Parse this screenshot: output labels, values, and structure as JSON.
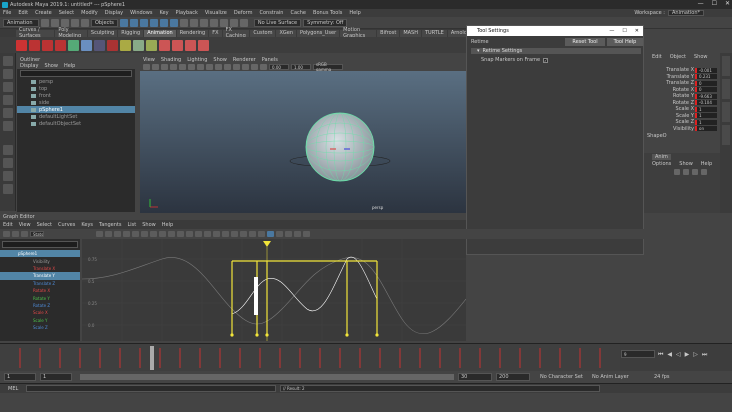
{
  "window": {
    "title": "Autodesk Maya 2019.1: untitled* --- pSphere1",
    "workspace": "Workspace :",
    "workspace_value": "Animation*"
  },
  "menubar": [
    "File",
    "Edit",
    "Create",
    "Select",
    "Modify",
    "Display",
    "Windows",
    "Key",
    "Playback",
    "Visualize",
    "Deform",
    "Constrain",
    "Cache",
    "Bonus Tools",
    "Help"
  ],
  "toolbar": {
    "menu_set": "Animation",
    "objects_label": "Objects",
    "live_surface": "No Live Surface",
    "symmetry": "Symmetry: Off"
  },
  "shelf_tabs": [
    "Curves / Surfaces",
    "Poly Modeling",
    "Sculpting",
    "Rigging",
    "Animation",
    "Rendering",
    "FX",
    "FX Caching",
    "Custom",
    "XGen",
    "Polygons_User",
    "Motion Graphics",
    "Bifrost",
    "MASH",
    "TURTLE",
    "Arnold"
  ],
  "shelf_active": 4,
  "outliner": {
    "title": "Outliner",
    "menu": [
      "Display",
      "Show",
      "Help"
    ],
    "rows": [
      {
        "label": "persp",
        "sel": false
      },
      {
        "label": "top",
        "sel": false
      },
      {
        "label": "front",
        "sel": false
      },
      {
        "label": "side",
        "sel": false
      },
      {
        "label": "pSphere1",
        "sel": true
      },
      {
        "label": "defaultLightSet",
        "sel": false
      },
      {
        "label": "defaultObjectSet",
        "sel": false
      }
    ]
  },
  "viewport": {
    "menu": [
      "View",
      "Shading",
      "Lighting",
      "Show",
      "Renderer",
      "Panels"
    ],
    "field_a": "0.00",
    "field_b": "1.00",
    "color_space": "sRGB gamma",
    "camera": "persp"
  },
  "tool_settings": {
    "title": "Tool Settings",
    "tool_name": "Retime",
    "reset_label": "Reset Tool",
    "help_label": "Tool Help",
    "section": "Retime Settings",
    "option_label": "Snap Markers on Frame",
    "option_checked": true,
    "option_mark": "✓"
  },
  "channel_box": {
    "tabs": [
      "Edit",
      "Object",
      "Show"
    ],
    "channels": [
      {
        "name": "Translate X",
        "value": "-0.001"
      },
      {
        "name": "Translate Y",
        "value": "0.231"
      },
      {
        "name": "Translate Z",
        "value": "0"
      },
      {
        "name": "Rotate X",
        "value": "0"
      },
      {
        "name": "Rotate Y",
        "value": "-9.663"
      },
      {
        "name": "Rotate Z",
        "value": "-0.104"
      },
      {
        "name": "Scale X",
        "value": "1"
      },
      {
        "name": "Scale Y",
        "value": "1"
      },
      {
        "name": "Scale Z",
        "value": "1"
      },
      {
        "name": "Visibility",
        "value": "on"
      }
    ],
    "object": "ShapeO",
    "layer_tabs": [
      "Anim"
    ],
    "layer_menu": [
      "Options",
      "Show",
      "Help"
    ]
  },
  "graph_editor": {
    "title": "Graph Editor",
    "menu": [
      "Edit",
      "View",
      "Select",
      "Curves",
      "Keys",
      "Tangents",
      "List",
      "Show",
      "Help"
    ],
    "stats_label": "Stats",
    "list": [
      {
        "label": "pSphere1",
        "cls": "hdr sel"
      },
      {
        "label": "Visibility",
        "cls": ""
      },
      {
        "label": "Translate X",
        "cls": "red"
      },
      {
        "label": "Translate Y",
        "cls": "sel"
      },
      {
        "label": "Translate Z",
        "cls": "blue"
      },
      {
        "label": "Rotate X",
        "cls": "red"
      },
      {
        "label": "Rotate Y",
        "cls": "green"
      },
      {
        "label": "Rotate Z",
        "cls": "blue"
      },
      {
        "label": "Scale X",
        "cls": "red"
      },
      {
        "label": "Scale Y",
        "cls": "green"
      },
      {
        "label": "Scale Z",
        "cls": "blue"
      }
    ],
    "y_ticks": [
      "0.75",
      "0.5",
      "0.25",
      "0.0"
    ]
  },
  "timeline": {
    "current_frame": "9",
    "start": "1",
    "range_start": "1",
    "range_end": "30",
    "end": "200",
    "char_set": "No Character Set",
    "anim_layer": "No Anim Layer",
    "fps": "24 fps"
  },
  "command": {
    "lang": "MEL",
    "result": "// Result: 2"
  },
  "colors": {
    "accent": "#5285a6",
    "selection_yellow": "#f2e53a",
    "key_red": "#c43030",
    "wire_green": "#69e0a8"
  }
}
